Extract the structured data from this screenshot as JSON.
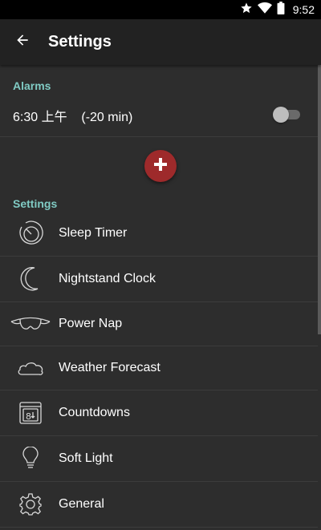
{
  "status_bar": {
    "time": "9:52",
    "icons": [
      "star-icon",
      "wifi-icon",
      "battery-icon"
    ]
  },
  "app_bar": {
    "title": "Settings",
    "back_icon": "arrow-left-icon"
  },
  "alarms": {
    "header": "Alarms",
    "items": [
      {
        "label": "6:30 上午    (-20 min)",
        "enabled": false
      }
    ]
  },
  "add_button": {
    "icon": "plus-icon",
    "color": "#9e2a2b"
  },
  "settings": {
    "header": "Settings",
    "items": [
      {
        "label": "Sleep Timer",
        "icon": "sleep-timer-icon"
      },
      {
        "label": "Nightstand Clock",
        "icon": "moon-icon"
      },
      {
        "label": "Power Nap",
        "icon": "sleep-mask-icon"
      },
      {
        "label": "Weather Forecast",
        "icon": "cloud-icon"
      },
      {
        "label": "Countdowns",
        "icon": "calendar-icon"
      },
      {
        "label": "Soft Light",
        "icon": "lightbulb-icon"
      },
      {
        "label": "General",
        "icon": "gear-icon"
      }
    ]
  },
  "colors": {
    "accent": "#80cbc4",
    "background": "#2d2d2d",
    "app_bar": "#222222"
  }
}
